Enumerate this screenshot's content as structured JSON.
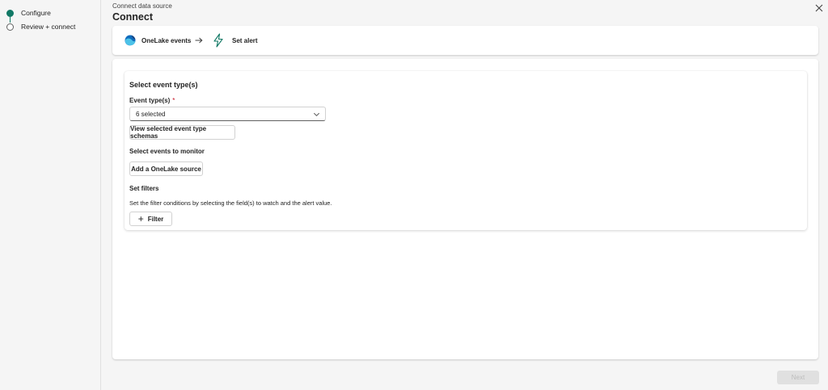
{
  "wizard": {
    "steps": [
      {
        "label": "Configure",
        "state": "active"
      },
      {
        "label": "Review + connect",
        "state": "pending"
      }
    ]
  },
  "header": {
    "breadcrumb": "Connect data source",
    "title": "Connect",
    "close_icon": "close-icon"
  },
  "flow": {
    "source_label": "OneLake events",
    "source_icon": "onelake-icon",
    "arrow_icon": "arrow-right-icon",
    "target_label": "Set alert",
    "target_icon": "lightning-icon"
  },
  "event_section": {
    "title": "Select event type(s)",
    "field_label": "Event type(s)",
    "required_marker": "*",
    "dropdown_value": "6 selected",
    "view_schemas_button": "View selected event type schemas"
  },
  "monitor_section": {
    "title": "Select events to monitor",
    "add_source_button": "Add a OneLake source"
  },
  "filter_section": {
    "title": "Set filters",
    "help_text": "Set the filter conditions by selecting the field(s) to watch and the alert value.",
    "filter_button": "Filter"
  },
  "footer": {
    "next_button": "Next",
    "next_disabled": true
  },
  "colors": {
    "accent": "#117865",
    "required": "#c50f1f",
    "onelake_blue": "#0f6cbd",
    "onelake_light": "#4cc2e8"
  }
}
